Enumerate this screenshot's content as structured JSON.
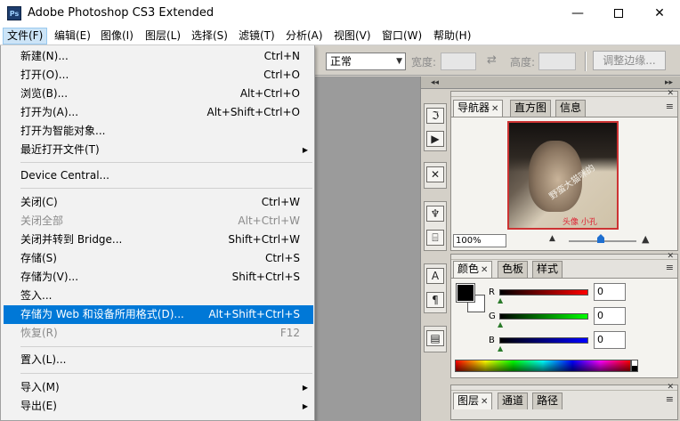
{
  "window": {
    "app_icon": "Ps",
    "title": "Adobe Photoshop CS3 Extended",
    "min_glyph": "—",
    "close_glyph": "✕"
  },
  "menubar": {
    "items": [
      "文件(F)",
      "编辑(E)",
      "图像(I)",
      "图层(L)",
      "选择(S)",
      "滤镜(T)",
      "分析(A)",
      "视图(V)",
      "窗口(W)",
      "帮助(H)"
    ]
  },
  "options_bar": {
    "style_value": "正常",
    "width_label": "宽度:",
    "swap_glyph": "⇄",
    "height_label": "高度:",
    "refine_button": "调整边缘..."
  },
  "dock": {
    "collapse_glyph": "◂◂",
    "tool_glyphs": [
      "ℑ",
      "▶",
      "✕",
      "♆",
      "⌸",
      "A",
      "¶",
      "▤"
    ]
  },
  "panels": {
    "column_glyph": "▸▸",
    "close_glyph": "✕",
    "menu_glyph": "≡",
    "navigator": {
      "tabs": [
        "导航器",
        "直方图",
        "信息"
      ],
      "zoom_value": "100%",
      "watermark": "野蛮大猫咪的",
      "signature": "头像 小孔",
      "zoom_out_glyph": "▲",
      "zoom_in_glyph": "▲"
    },
    "color": {
      "tabs": [
        "颜色",
        "色板",
        "样式"
      ],
      "channels": [
        {
          "label": "R",
          "value": "0",
          "color": "#ff0000"
        },
        {
          "label": "G",
          "value": "0",
          "color": "#00ff00"
        },
        {
          "label": "B",
          "value": "0",
          "color": "#0000ff"
        }
      ],
      "slider_glyph": "▲"
    },
    "layers": {
      "tabs": [
        "图层",
        "通道",
        "路径"
      ]
    }
  },
  "file_menu": {
    "submenu_glyph": "▶",
    "items": [
      {
        "label": "新建(N)...",
        "shortcut": "Ctrl+N",
        "state": "normal"
      },
      {
        "label": "打开(O)...",
        "shortcut": "Ctrl+O",
        "state": "normal"
      },
      {
        "label": "浏览(B)...",
        "shortcut": "Alt+Ctrl+O",
        "state": "normal"
      },
      {
        "label": "打开为(A)...",
        "shortcut": "Alt+Shift+Ctrl+O",
        "state": "normal"
      },
      {
        "label": "打开为智能对象...",
        "shortcut": "",
        "state": "normal"
      },
      {
        "label": "最近打开文件(T)",
        "shortcut": "",
        "state": "submenu"
      },
      {
        "label": "Device Central...",
        "shortcut": "",
        "state": "normal"
      },
      {
        "label": "关闭(C)",
        "shortcut": "Ctrl+W",
        "state": "normal"
      },
      {
        "label": "关闭全部",
        "shortcut": "Alt+Ctrl+W",
        "state": "disabled"
      },
      {
        "label": "关闭并转到 Bridge...",
        "shortcut": "Shift+Ctrl+W",
        "state": "normal"
      },
      {
        "label": "存储(S)",
        "shortcut": "Ctrl+S",
        "state": "normal"
      },
      {
        "label": "存储为(V)...",
        "shortcut": "Shift+Ctrl+S",
        "state": "normal"
      },
      {
        "label": "签入...",
        "shortcut": "",
        "state": "normal"
      },
      {
        "label": "存储为 Web 和设备所用格式(D)...",
        "shortcut": "Alt+Shift+Ctrl+S",
        "state": "highlight"
      },
      {
        "label": "恢复(R)",
        "shortcut": "F12",
        "state": "disabled"
      },
      {
        "label": "置入(L)...",
        "shortcut": "",
        "state": "normal"
      },
      {
        "label": "导入(M)",
        "shortcut": "",
        "state": "submenu"
      },
      {
        "label": "导出(E)",
        "shortcut": "",
        "state": "submenu"
      }
    ]
  }
}
